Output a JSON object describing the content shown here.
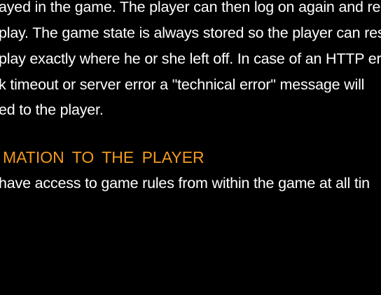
{
  "paragraph": {
    "lines": [
      "ayed in the game. The player can then log on again and re",
      "play. The game state is always stored so the player can resu",
      "play exactly where he or she left off. In case of an HTTP err",
      "k timeout or server error a \"technical error\" message will",
      "ed to the player."
    ]
  },
  "section": {
    "heading": "MATION TO THE PLAYER",
    "body": " have access to game rules from within the game at all tin"
  },
  "colors": {
    "background": "#000000",
    "text": "#ffffff",
    "heading": "#f29a1f"
  }
}
